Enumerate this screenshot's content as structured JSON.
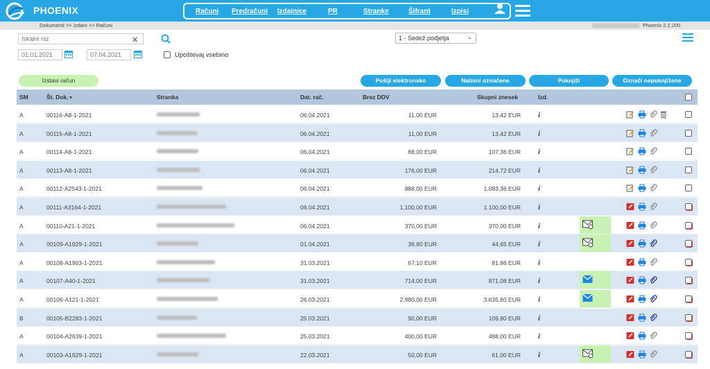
{
  "app": {
    "name": "PHOENIX",
    "version": "Phoenix 2.2.200"
  },
  "nav": {
    "items": [
      "Računi",
      "Predračuni",
      "Izdajnice",
      "PR",
      "Stranke",
      "Šifrant",
      "Izpisi"
    ]
  },
  "breadcrumb": "Dokumenti >> Izdani >> Računi",
  "filters": {
    "search_placeholder": "Iskalni niz",
    "date_from": "01.01.2021",
    "date_to": "07.04.2021",
    "content_checkbox_label": "Upoštevaj vsebino",
    "session_select": "1 - Sedež podjetja"
  },
  "actions": {
    "issue": "Izstavi račun",
    "send": "Pošlji elektronsko",
    "print": "Natisni označene",
    "post": "Poknjiži",
    "mark": "Označi nepoknjižene"
  },
  "table": {
    "headers": {
      "sm": "SM",
      "doc": "Št. Dok.",
      "customer": "Stranka",
      "date": "Dat. rač.",
      "net": "Brez DDV",
      "gross": "Skupni znesek",
      "izd": "Izd."
    },
    "rows": [
      {
        "sm": "A",
        "doc": "00116-A8-1-2021",
        "date": "06.04.2021",
        "net": "11,00 EUR",
        "gross": "13,42 EUR",
        "status": "draft",
        "mail": "",
        "delete": true
      },
      {
        "sm": "A",
        "doc": "00115-A8-1-2021",
        "date": "06.04.2021",
        "net": "11,00 EUR",
        "gross": "13,42 EUR",
        "status": "draft",
        "mail": "",
        "delete": false
      },
      {
        "sm": "A",
        "doc": "00114-A8-1-2021",
        "date": "06.04.2021",
        "net": "88,00 EUR",
        "gross": "107,36 EUR",
        "status": "draft",
        "mail": "",
        "delete": false
      },
      {
        "sm": "A",
        "doc": "00113-A8-1-2021",
        "date": "06.04.2021",
        "net": "176,00 EUR",
        "gross": "214,72 EUR",
        "status": "draft",
        "mail": "",
        "delete": false
      },
      {
        "sm": "A",
        "doc": "00112-A2543-1-2021",
        "date": "06.04.2021",
        "net": "888,00 EUR",
        "gross": "1.083,36 EUR",
        "status": "draft",
        "mail": "",
        "delete": false
      },
      {
        "sm": "A",
        "doc": "00111-A3164-1-2021",
        "date": "06.04.2021",
        "net": "1.100,00 EUR",
        "gross": "1.100,00 EUR",
        "status": "posted",
        "mail": "",
        "delete": false
      },
      {
        "sm": "A",
        "doc": "00110-A21-1-2021",
        "date": "06.04.2021",
        "net": "370,00 EUR",
        "gross": "370,00 EUR",
        "status": "posted",
        "mail": "pending",
        "delete": false
      },
      {
        "sm": "A",
        "doc": "00109-A1929-1-2021",
        "date": "01.04.2021",
        "net": "36,60 EUR",
        "gross": "44,65 EUR",
        "status": "posted",
        "mail": "pending",
        "delete": false
      },
      {
        "sm": "A",
        "doc": "00108-A1903-1-2021",
        "date": "31.03.2021",
        "net": "67,10 EUR",
        "gross": "81,86 EUR",
        "status": "posted",
        "mail": "",
        "delete": false
      },
      {
        "sm": "A",
        "doc": "00107-A40-1-2021",
        "date": "31.03.2021",
        "net": "714,00 EUR",
        "gross": "871,08 EUR",
        "status": "posted",
        "mail": "sent",
        "delete": false
      },
      {
        "sm": "A",
        "doc": "00106-A121-1-2021",
        "date": "26.03.2021",
        "net": "2.980,00 EUR",
        "gross": "3.635,60 EUR",
        "status": "posted",
        "mail": "sent",
        "delete": false
      },
      {
        "sm": "B",
        "doc": "00105-B2283-1-2021",
        "date": "25.03.2021",
        "net": "90,00 EUR",
        "gross": "109,80 EUR",
        "status": "posted",
        "mail": "",
        "delete": false
      },
      {
        "sm": "A",
        "doc": "00104-A2639-1-2021",
        "date": "25.03.2021",
        "net": "400,00 EUR",
        "gross": "488,00 EUR",
        "status": "posted",
        "mail": "",
        "delete": false
      },
      {
        "sm": "A",
        "doc": "00103-A1929-1-2021",
        "date": "22.03.2021",
        "net": "50,00 EUR",
        "gross": "61,00 EUR",
        "status": "posted",
        "mail": "pending",
        "delete": false
      }
    ]
  },
  "colors": {
    "accent": "#27a7e3",
    "header_row": "#b2c7dd",
    "alt_row": "#dbe6f4",
    "green": "#c7f2b1",
    "red": "#e53935"
  }
}
